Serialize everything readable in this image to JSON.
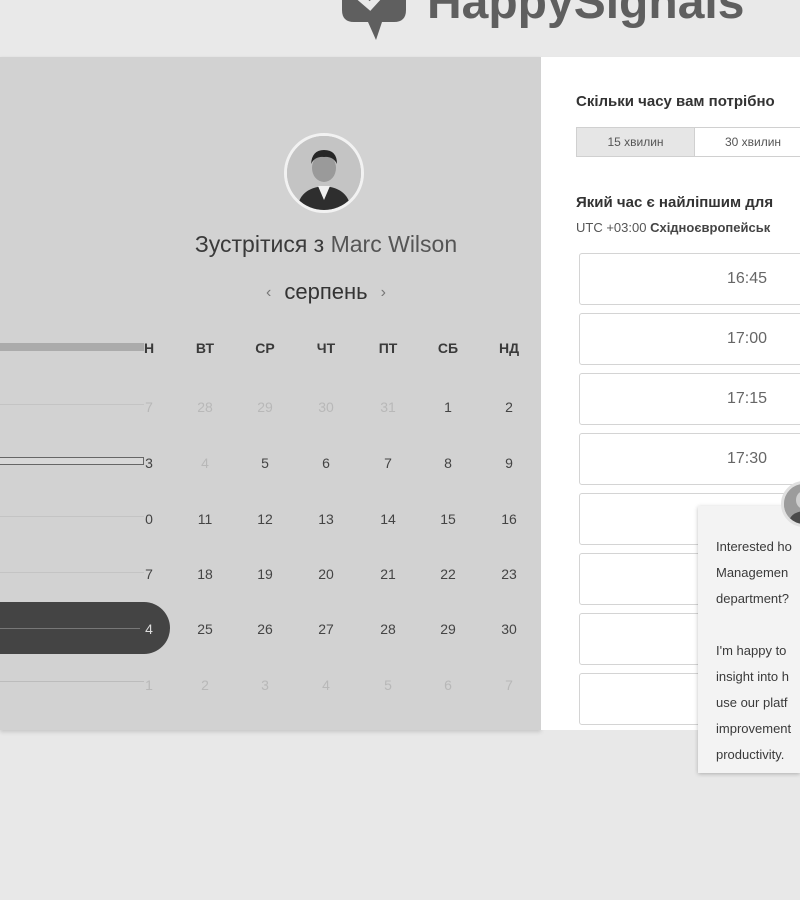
{
  "header": {
    "brand": "HappySignals"
  },
  "scheduler": {
    "meet_prefix": "Зустрітися з",
    "host_name": "Marc Wilson",
    "month": "серпень",
    "weekdays": [
      "Н",
      "ВТ",
      "СР",
      "ЧТ",
      "ПТ",
      "СБ",
      "НД"
    ],
    "weeks": [
      [
        "7",
        "28",
        "29",
        "30",
        "31",
        "1",
        "2"
      ],
      [
        "3",
        "4",
        "5",
        "6",
        "7",
        "8",
        "9"
      ],
      [
        "0",
        "11",
        "12",
        "13",
        "14",
        "15",
        "16"
      ],
      [
        "7",
        "18",
        "19",
        "20",
        "21",
        "22",
        "23"
      ],
      [
        "4",
        "25",
        "26",
        "27",
        "28",
        "29",
        "30"
      ],
      [
        "1",
        "2",
        "3",
        "4",
        "5",
        "6",
        "7"
      ]
    ]
  },
  "booking": {
    "duration_question": "Скільки часу вам потрібно",
    "durations": [
      "15 хвилин",
      "30 хвилин"
    ],
    "selected_duration": "15 хвилин",
    "time_question": "Який час є найліпшим для",
    "timezone_offset": "UTC +03:00",
    "timezone_name": "Східноєвропейськ",
    "slots": [
      "16:45",
      "17:00",
      "17:15",
      "17:30",
      "",
      "",
      ""
    ]
  },
  "chat": {
    "message": "Interested ho\nManagemen\ndepartment?\n\nI'm happy to\ninsight into h\nuse our platf\nimprovement\nproductivity."
  }
}
